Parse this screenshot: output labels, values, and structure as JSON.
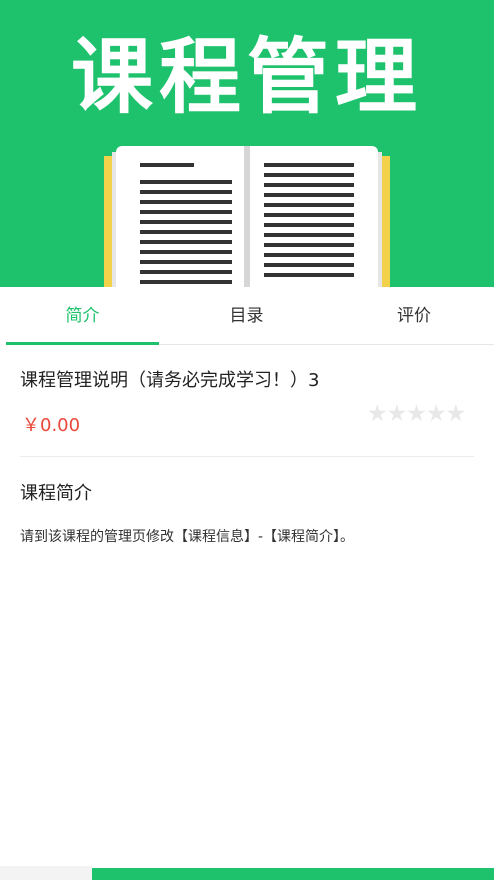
{
  "banner": {
    "title": "课程管理"
  },
  "tabs": [
    {
      "label": "简介",
      "active": true
    },
    {
      "label": "目录",
      "active": false
    },
    {
      "label": "评价",
      "active": false
    }
  ],
  "course": {
    "title": "课程管理说明（请务必完成学习！）3",
    "price": "￥0.00",
    "rating": {
      "value": 0,
      "max": 5,
      "glyphs": "★★★★★"
    }
  },
  "intro": {
    "heading": "课程简介",
    "text": "请到该课程的管理页修改【课程信息】-【课程简介】。"
  },
  "colors": {
    "accent": "#1ec26d",
    "price": "#e8493b",
    "star_empty": "#e8e8e8"
  }
}
